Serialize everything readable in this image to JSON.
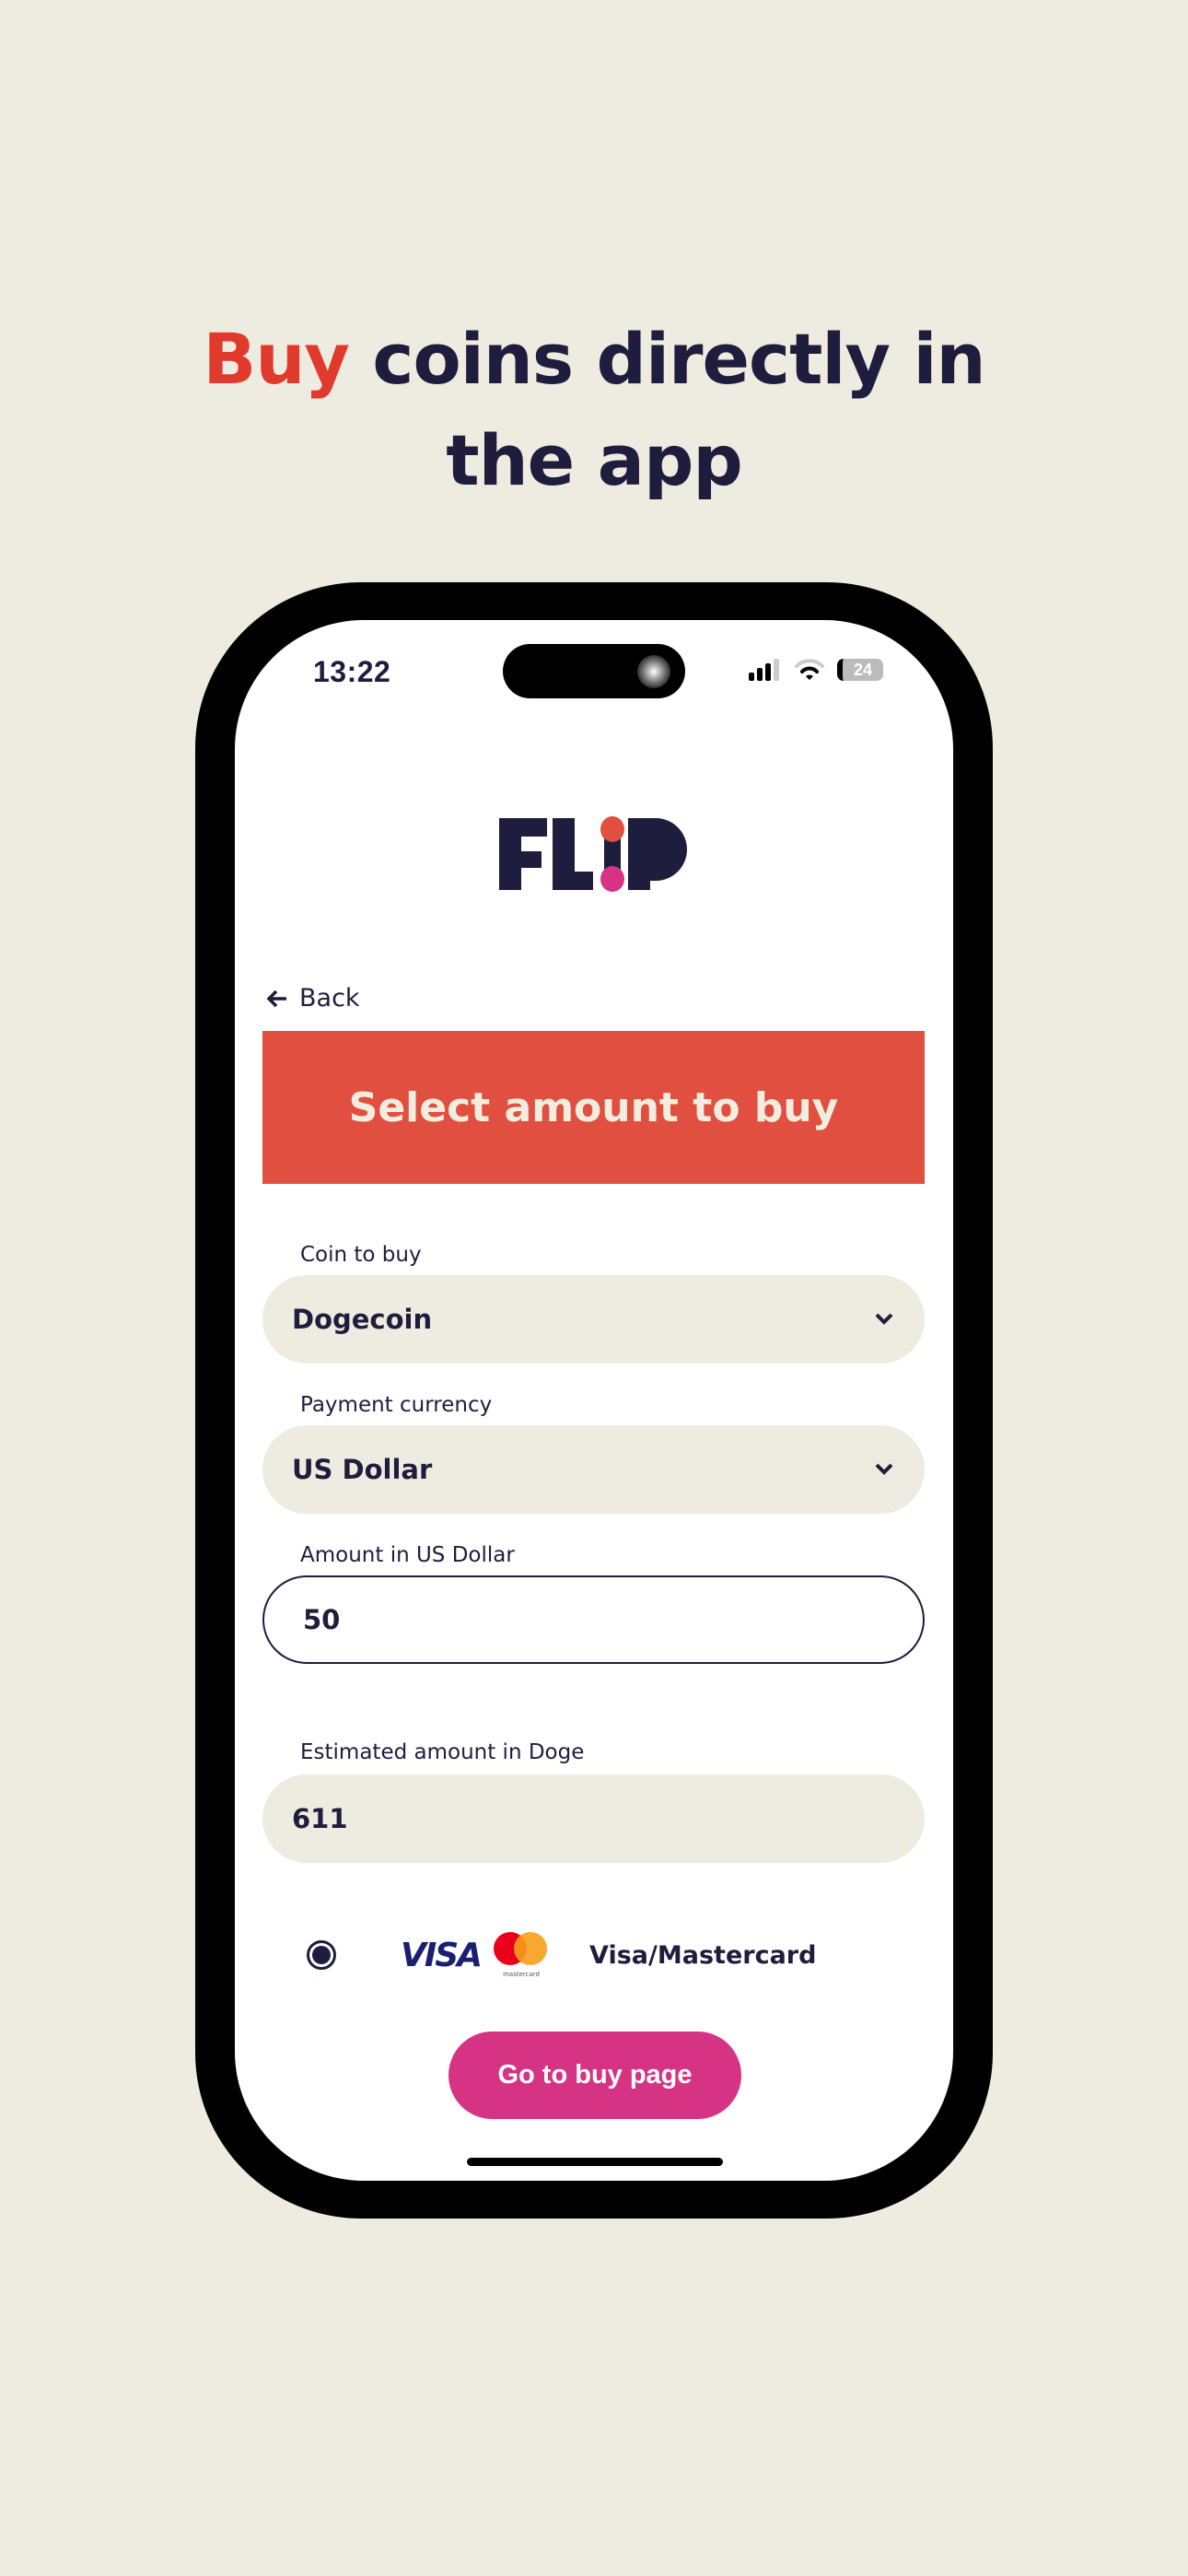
{
  "headline": {
    "accent": "Buy",
    "rest_line1": " coins directly in",
    "line2": "the app"
  },
  "status_bar": {
    "time": "13:22",
    "battery": "24",
    "icons": [
      "signal-icon",
      "wifi-icon",
      "battery-icon"
    ]
  },
  "app": {
    "logo": "FLIP",
    "back_label": "Back",
    "banner_title": "Select amount to buy"
  },
  "form": {
    "coin_label": "Coin to buy",
    "coin_value": "Dogecoin",
    "currency_label": "Payment currency",
    "currency_value": "US Dollar",
    "amount_label": "Amount in US Dollar",
    "amount_value": "50",
    "estimate_label": "Estimated amount in Doge",
    "estimate_value": "611"
  },
  "payment": {
    "visa": "VISA",
    "mastercard": "mastercard",
    "method_label": "Visa/Mastercard",
    "selected": true
  },
  "cta": {
    "label": "Go to buy page"
  },
  "colors": {
    "background": "#eeebe0",
    "text": "#1f1d3d",
    "banner": "#e04f40",
    "accent": "#e03a2c",
    "button": "#d63384"
  }
}
